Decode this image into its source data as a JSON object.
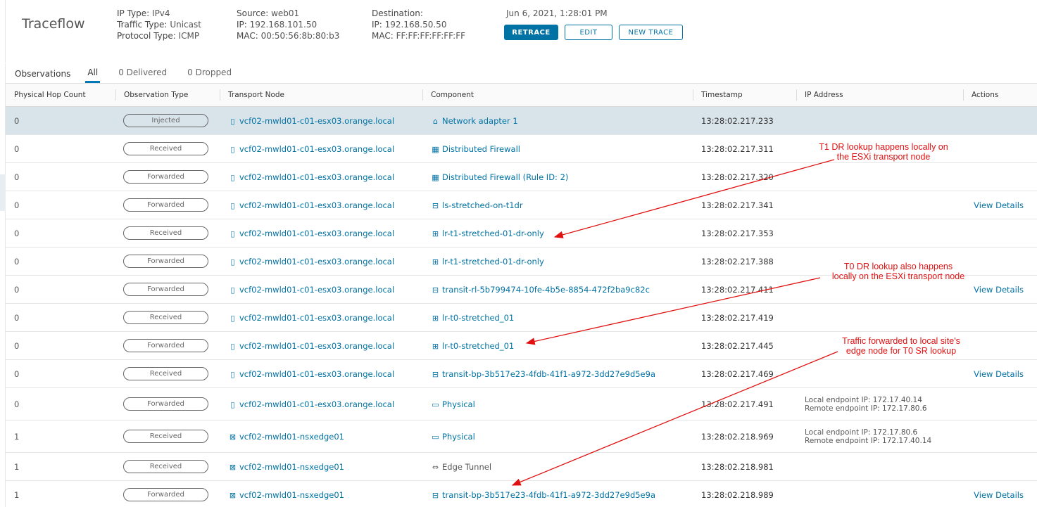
{
  "header": {
    "title": "Traceflow",
    "ip_type_label": "IP Type:",
    "ip_type": "IPv4",
    "traffic_type_label": "Traffic Type:",
    "traffic_type": "Unicast",
    "protocol_type_label": "Protocol Type:",
    "protocol_type": "ICMP",
    "source_label": "Source:",
    "source": "web01",
    "source_ip_label": "IP:",
    "source_ip": "192.168.101.50",
    "source_mac_label": "MAC:",
    "source_mac": "00:50:56:8b:80:b3",
    "dest_label": "Destination:",
    "dest_ip_label": "IP:",
    "dest_ip": "192.168.50.50",
    "dest_mac_label": "MAC:",
    "dest_mac": "FF:FF:FF:FF:FF:FF",
    "timestamp": "Jun 6, 2021, 1:28:01 PM",
    "retrace_label": "RETRACE",
    "edit_label": "EDIT",
    "new_trace_label": "NEW TRACE"
  },
  "tabs": {
    "label": "Observations",
    "items": [
      "All",
      "0 Delivered",
      "0 Dropped"
    ]
  },
  "table": {
    "columns": [
      "Physical Hop Count",
      "Observation Type",
      "Transport Node",
      "Component",
      "Timestamp",
      "IP Address",
      "Actions"
    ],
    "rows": [
      {
        "hop": "0",
        "type": "Injected",
        "node": "vcf02-mwld01-c01-esx03.orange.local",
        "node_icon": "host-icon",
        "component": "Network adapter 1",
        "comp_icon": "network-adapter-icon",
        "ts": "13:28:02.217.233",
        "ip1": "",
        "ip2": "",
        "action": ""
      },
      {
        "hop": "0",
        "type": "Received",
        "node": "vcf02-mwld01-c01-esx03.orange.local",
        "node_icon": "host-icon",
        "component": "Distributed Firewall",
        "comp_icon": "firewall-icon",
        "ts": "13:28:02.217.311",
        "ip1": "",
        "ip2": "",
        "action": ""
      },
      {
        "hop": "0",
        "type": "Forwarded",
        "node": "vcf02-mwld01-c01-esx03.orange.local",
        "node_icon": "host-icon",
        "component": "Distributed Firewall (Rule ID: 2)",
        "comp_icon": "firewall-icon",
        "ts": "13:28:02.217.320",
        "ip1": "",
        "ip2": "",
        "action": ""
      },
      {
        "hop": "0",
        "type": "Forwarded",
        "node": "vcf02-mwld01-c01-esx03.orange.local",
        "node_icon": "host-icon",
        "component": "ls-stretched-on-t1dr",
        "comp_icon": "segment-icon",
        "ts": "13:28:02.217.341",
        "ip1": "",
        "ip2": "",
        "action": "View Details"
      },
      {
        "hop": "0",
        "type": "Received",
        "node": "vcf02-mwld01-c01-esx03.orange.local",
        "node_icon": "host-icon",
        "component": "lr-t1-stretched-01-dr-only",
        "comp_icon": "router-icon",
        "ts": "13:28:02.217.353",
        "ip1": "",
        "ip2": "",
        "action": ""
      },
      {
        "hop": "0",
        "type": "Forwarded",
        "node": "vcf02-mwld01-c01-esx03.orange.local",
        "node_icon": "host-icon",
        "component": "lr-t1-stretched-01-dr-only",
        "comp_icon": "router-icon",
        "ts": "13:28:02.217.388",
        "ip1": "",
        "ip2": "",
        "action": ""
      },
      {
        "hop": "0",
        "type": "Forwarded",
        "node": "vcf02-mwld01-c01-esx03.orange.local",
        "node_icon": "host-icon",
        "component": "transit-rl-5b799474-10fe-4b5e-8854-472f2ba9c82c",
        "comp_icon": "segment-icon",
        "ts": "13:28:02.217.411",
        "ip1": "",
        "ip2": "",
        "action": "View Details"
      },
      {
        "hop": "0",
        "type": "Received",
        "node": "vcf02-mwld01-c01-esx03.orange.local",
        "node_icon": "host-icon",
        "component": "lr-t0-stretched_01",
        "comp_icon": "router-icon",
        "ts": "13:28:02.217.419",
        "ip1": "",
        "ip2": "",
        "action": ""
      },
      {
        "hop": "0",
        "type": "Forwarded",
        "node": "vcf02-mwld01-c01-esx03.orange.local",
        "node_icon": "host-icon",
        "component": "lr-t0-stretched_01",
        "comp_icon": "router-icon",
        "ts": "13:28:02.217.445",
        "ip1": "",
        "ip2": "",
        "action": ""
      },
      {
        "hop": "0",
        "type": "Received",
        "node": "vcf02-mwld01-c01-esx03.orange.local",
        "node_icon": "host-icon",
        "component": "transit-bp-3b517e23-4fdb-41f1-a972-3dd27e9d5e9a",
        "comp_icon": "segment-icon",
        "ts": "13:28:02.217.469",
        "ip1": "",
        "ip2": "",
        "action": "View Details"
      },
      {
        "hop": "0",
        "type": "Forwarded",
        "node": "vcf02-mwld01-c01-esx03.orange.local",
        "node_icon": "host-icon",
        "component": "Physical",
        "comp_icon": "physical-icon",
        "ts": "13:28:02.217.491",
        "ip1": "Local endpoint IP: 172.17.40.14",
        "ip2": "Remote endpoint IP: 172.17.80.6",
        "action": ""
      },
      {
        "hop": "1",
        "type": "Received",
        "node": "vcf02-mwld01-nsxedge01",
        "node_icon": "edge-node-icon",
        "component": "Physical",
        "comp_icon": "physical-icon",
        "ts": "13:28:02.218.969",
        "ip1": "Local endpoint IP: 172.17.80.6",
        "ip2": "Remote endpoint IP: 172.17.40.14",
        "action": ""
      },
      {
        "hop": "1",
        "type": "Received",
        "node": "vcf02-mwld01-nsxedge01",
        "node_icon": "edge-node-icon",
        "component": "Edge Tunnel",
        "comp_icon": "tunnel-icon",
        "ts": "13:28:02.218.981",
        "ip1": "",
        "ip2": "",
        "action": ""
      },
      {
        "hop": "1",
        "type": "Forwarded",
        "node": "vcf02-mwld01-nsxedge01",
        "node_icon": "edge-node-icon",
        "component": "transit-bp-3b517e23-4fdb-41f1-a972-3dd27e9d5e9a",
        "comp_icon": "segment-icon",
        "ts": "13:28:02.218.989",
        "ip1": "",
        "ip2": "",
        "action": "View Details"
      }
    ]
  },
  "annotations": [
    {
      "line1": "T1 DR lookup happens locally on",
      "line2": "the ESXi transport node"
    },
    {
      "line1": "T0 DR lookup also happens",
      "line2": "locally on the ESXi transport node"
    },
    {
      "line1": "Traffic forwarded to local site's",
      "line2": "edge node for T0 SR lookup"
    }
  ],
  "colors": {
    "link": "#0072a3",
    "selected_row": "#d9e4ea",
    "annotation": "#e01010"
  }
}
